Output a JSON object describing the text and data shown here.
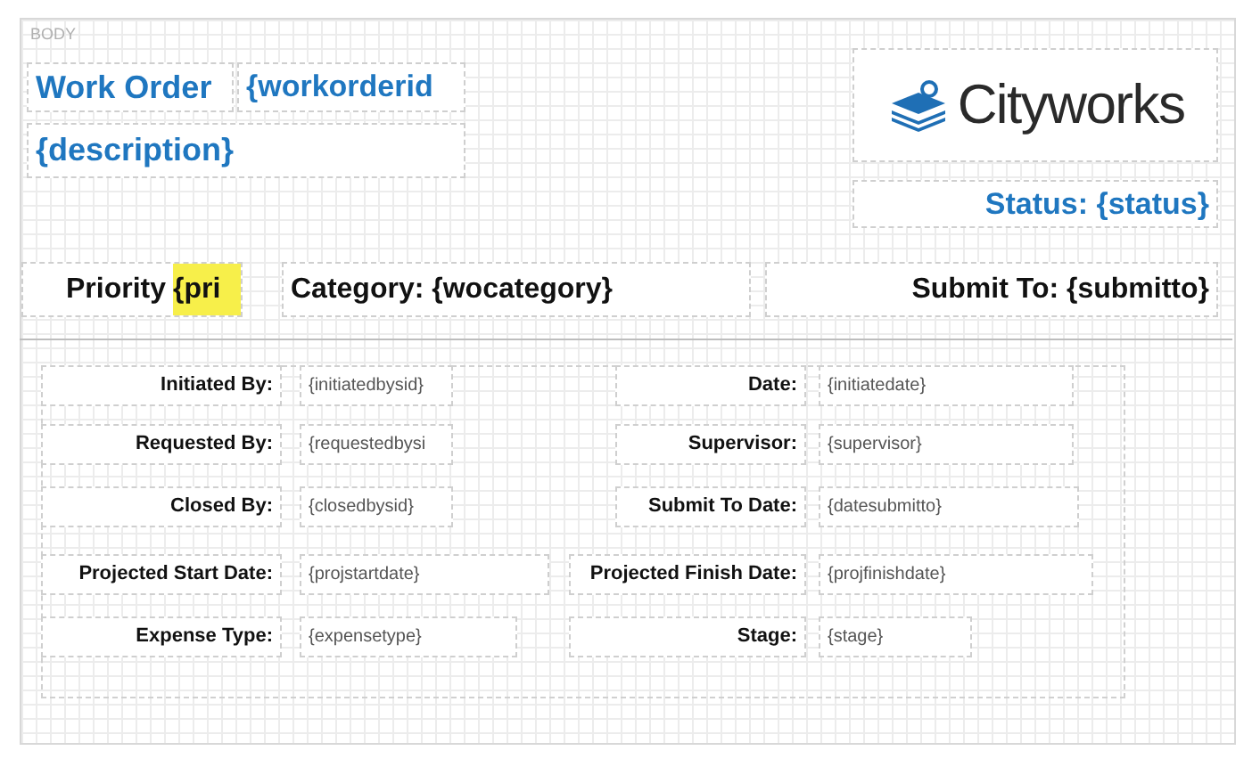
{
  "body_label": "BODY",
  "header": {
    "title": "Work Order",
    "id_field": "{workorderid",
    "description": "{description}",
    "logo_text": "Cityworks",
    "status": "Status: {status}"
  },
  "summary": {
    "priority_label": "Priority",
    "priority_value": "{pri",
    "priority_highlighted": true,
    "category": "Category: {wocategory}",
    "submit_to": "Submit To: {submitto}"
  },
  "fields": [
    {
      "label": "Initiated By:",
      "value": "{initiatedbysid}"
    },
    {
      "label": "Date:",
      "value": "{initiatedate}"
    },
    {
      "label": "Requested By:",
      "value": "{requestedbysi"
    },
    {
      "label": "Supervisor:",
      "value": "{supervisor}"
    },
    {
      "label": "Closed By:",
      "value": "{closedbysid}"
    },
    {
      "label": "Submit To Date:",
      "value": "{datesubmitto}"
    },
    {
      "label": "Projected Start Date:",
      "value": "{projstartdate}"
    },
    {
      "label": "Projected Finish Date:",
      "value": "{projfinishdate}"
    },
    {
      "label": "Expense Type:",
      "value": "{expensetype}"
    },
    {
      "label": "Stage:",
      "value": "{stage}"
    }
  ]
}
